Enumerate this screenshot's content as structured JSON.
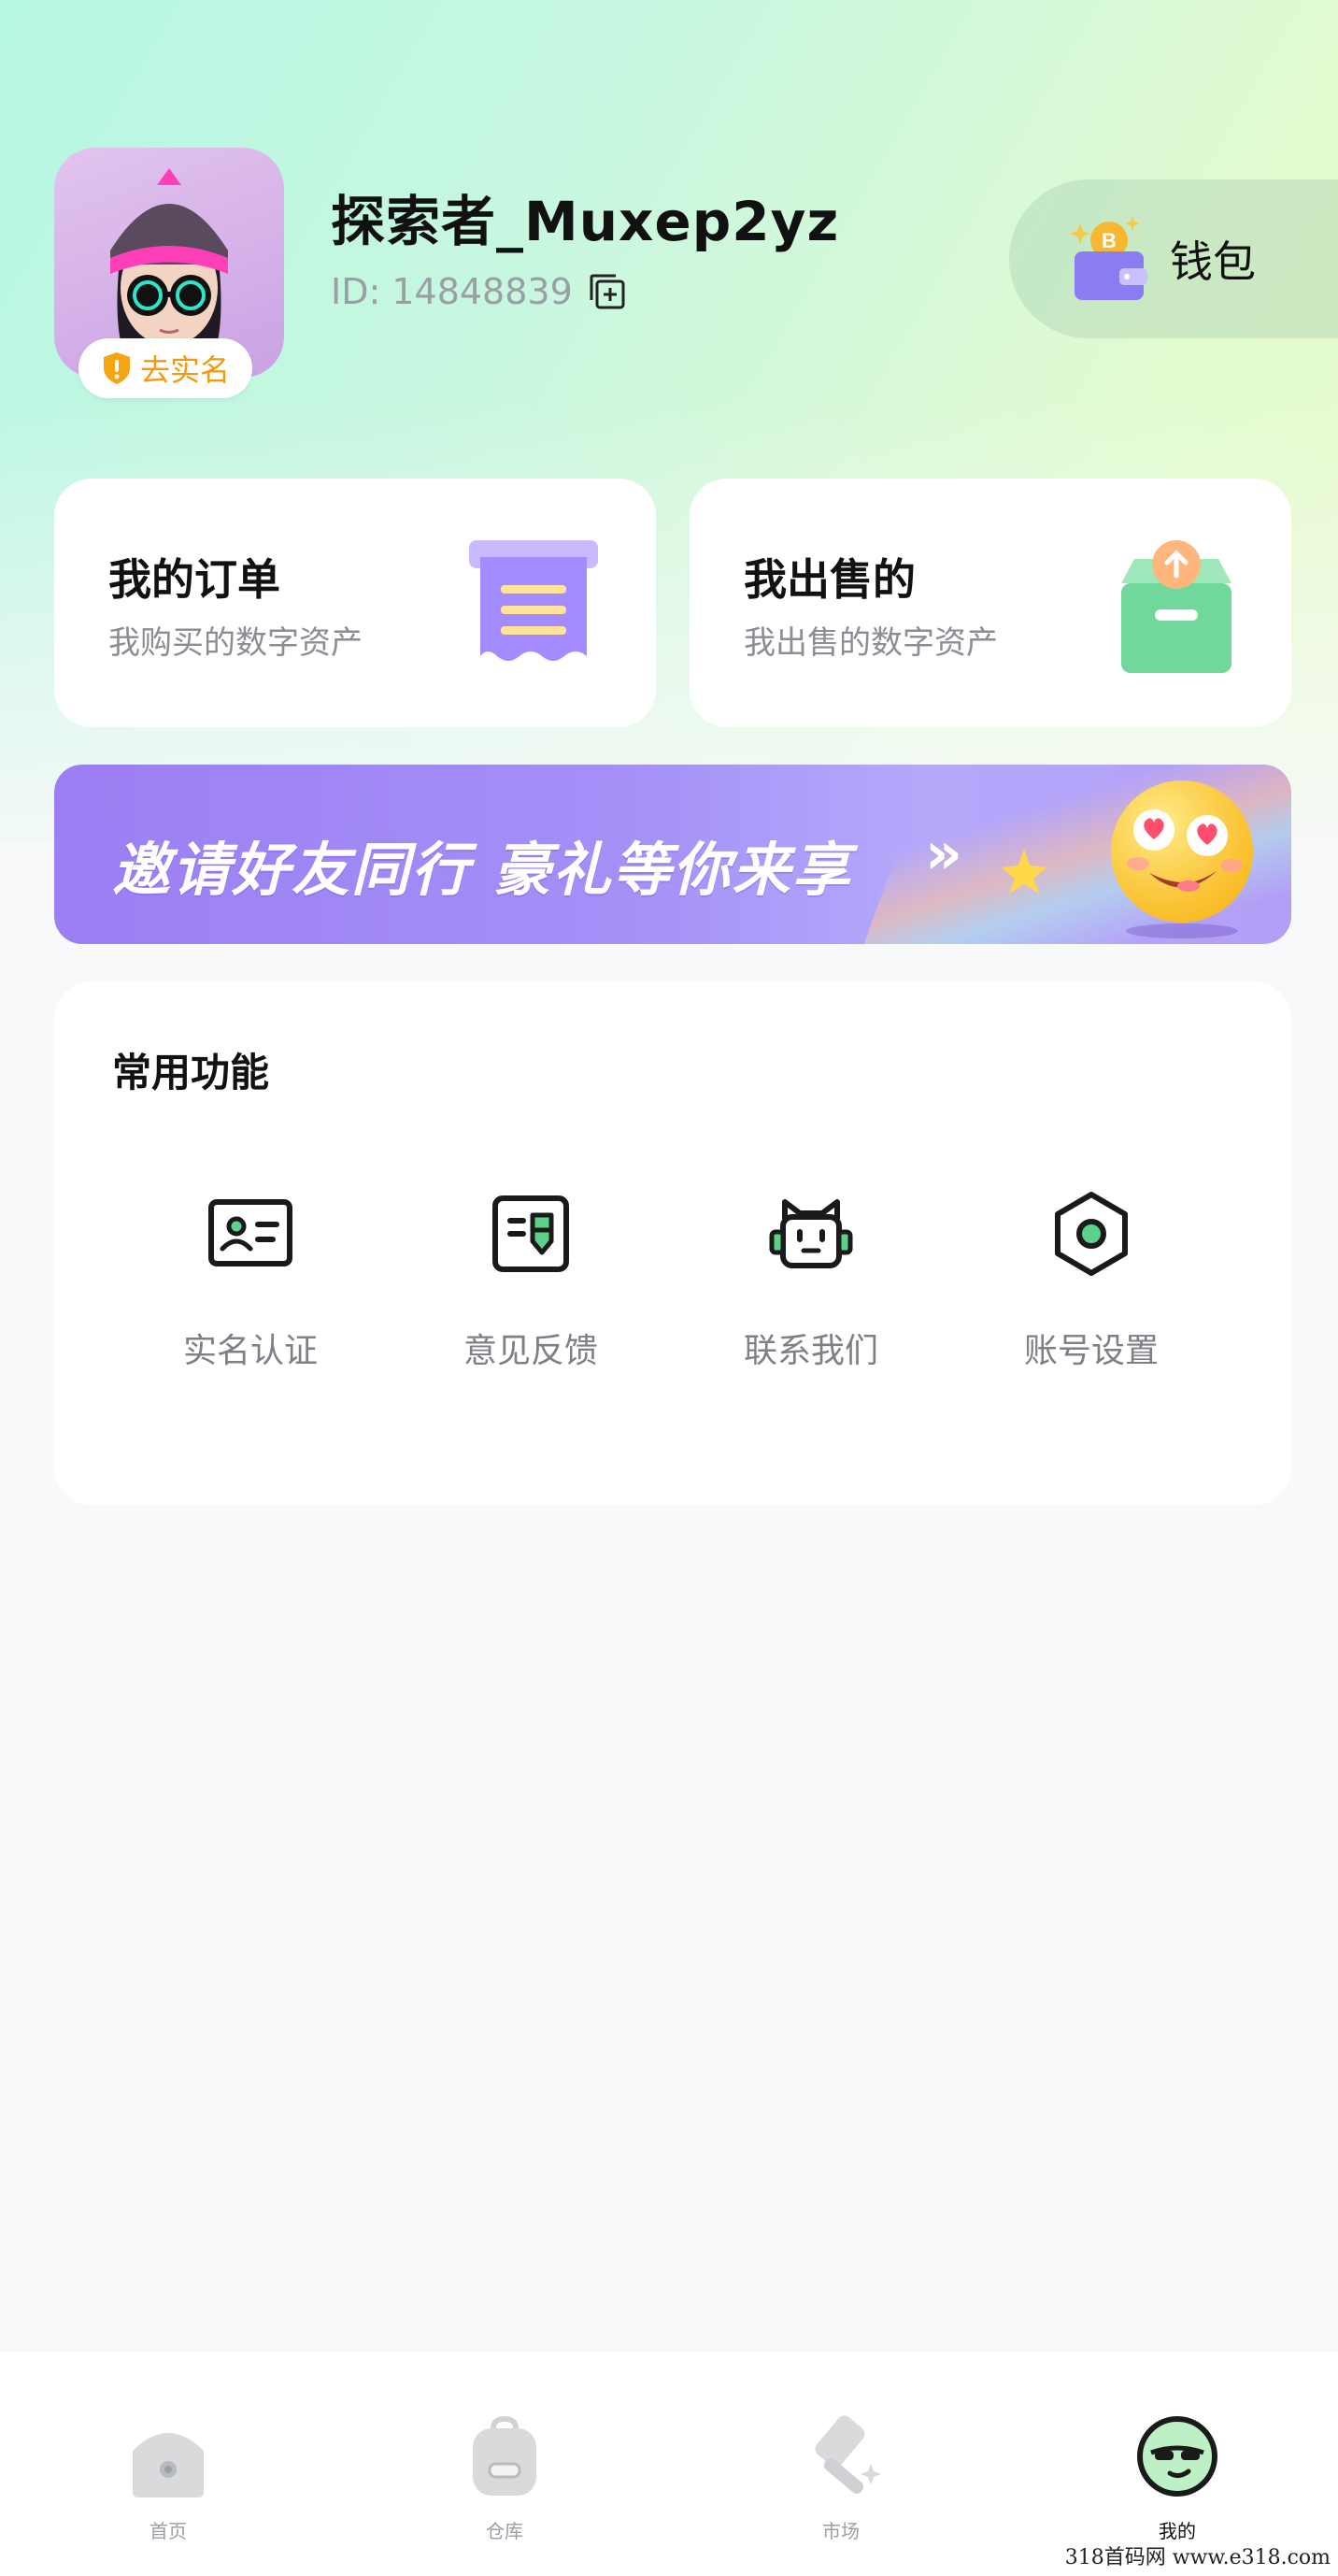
{
  "profile": {
    "username": "探索者_Muxep2yz",
    "user_id": "ID: 14848839",
    "verify_badge": "去实名",
    "wallet_label": "钱包"
  },
  "cards": [
    {
      "title": "我的订单",
      "subtitle": "我购买的数字资产"
    },
    {
      "title": "我出售的",
      "subtitle": "我出售的数字资产"
    }
  ],
  "banner": {
    "text": "邀请好友同行 豪礼等你来享",
    "arrow": "»"
  },
  "functions": {
    "title": "常用功能",
    "items": [
      {
        "label": "实名认证",
        "icon": "id-card-icon"
      },
      {
        "label": "意见反馈",
        "icon": "feedback-icon"
      },
      {
        "label": "联系我们",
        "icon": "customer-service-icon"
      },
      {
        "label": "账号设置",
        "icon": "settings-icon"
      }
    ]
  },
  "nav": {
    "items": [
      {
        "label": "首页",
        "icon": "home-icon",
        "active": false
      },
      {
        "label": "仓库",
        "icon": "backpack-icon",
        "active": false
      },
      {
        "label": "市场",
        "icon": "hammer-icon",
        "active": false
      },
      {
        "label": "我的",
        "icon": "profile-avatar-icon",
        "active": true
      }
    ]
  },
  "watermark": "318首码网  www.e318.com",
  "colors": {
    "accent_orange": "#f29a0b",
    "banner_purple": "#9c7ff3",
    "icon_green": "#5cd18a",
    "text_secondary": "#8a8d93"
  }
}
